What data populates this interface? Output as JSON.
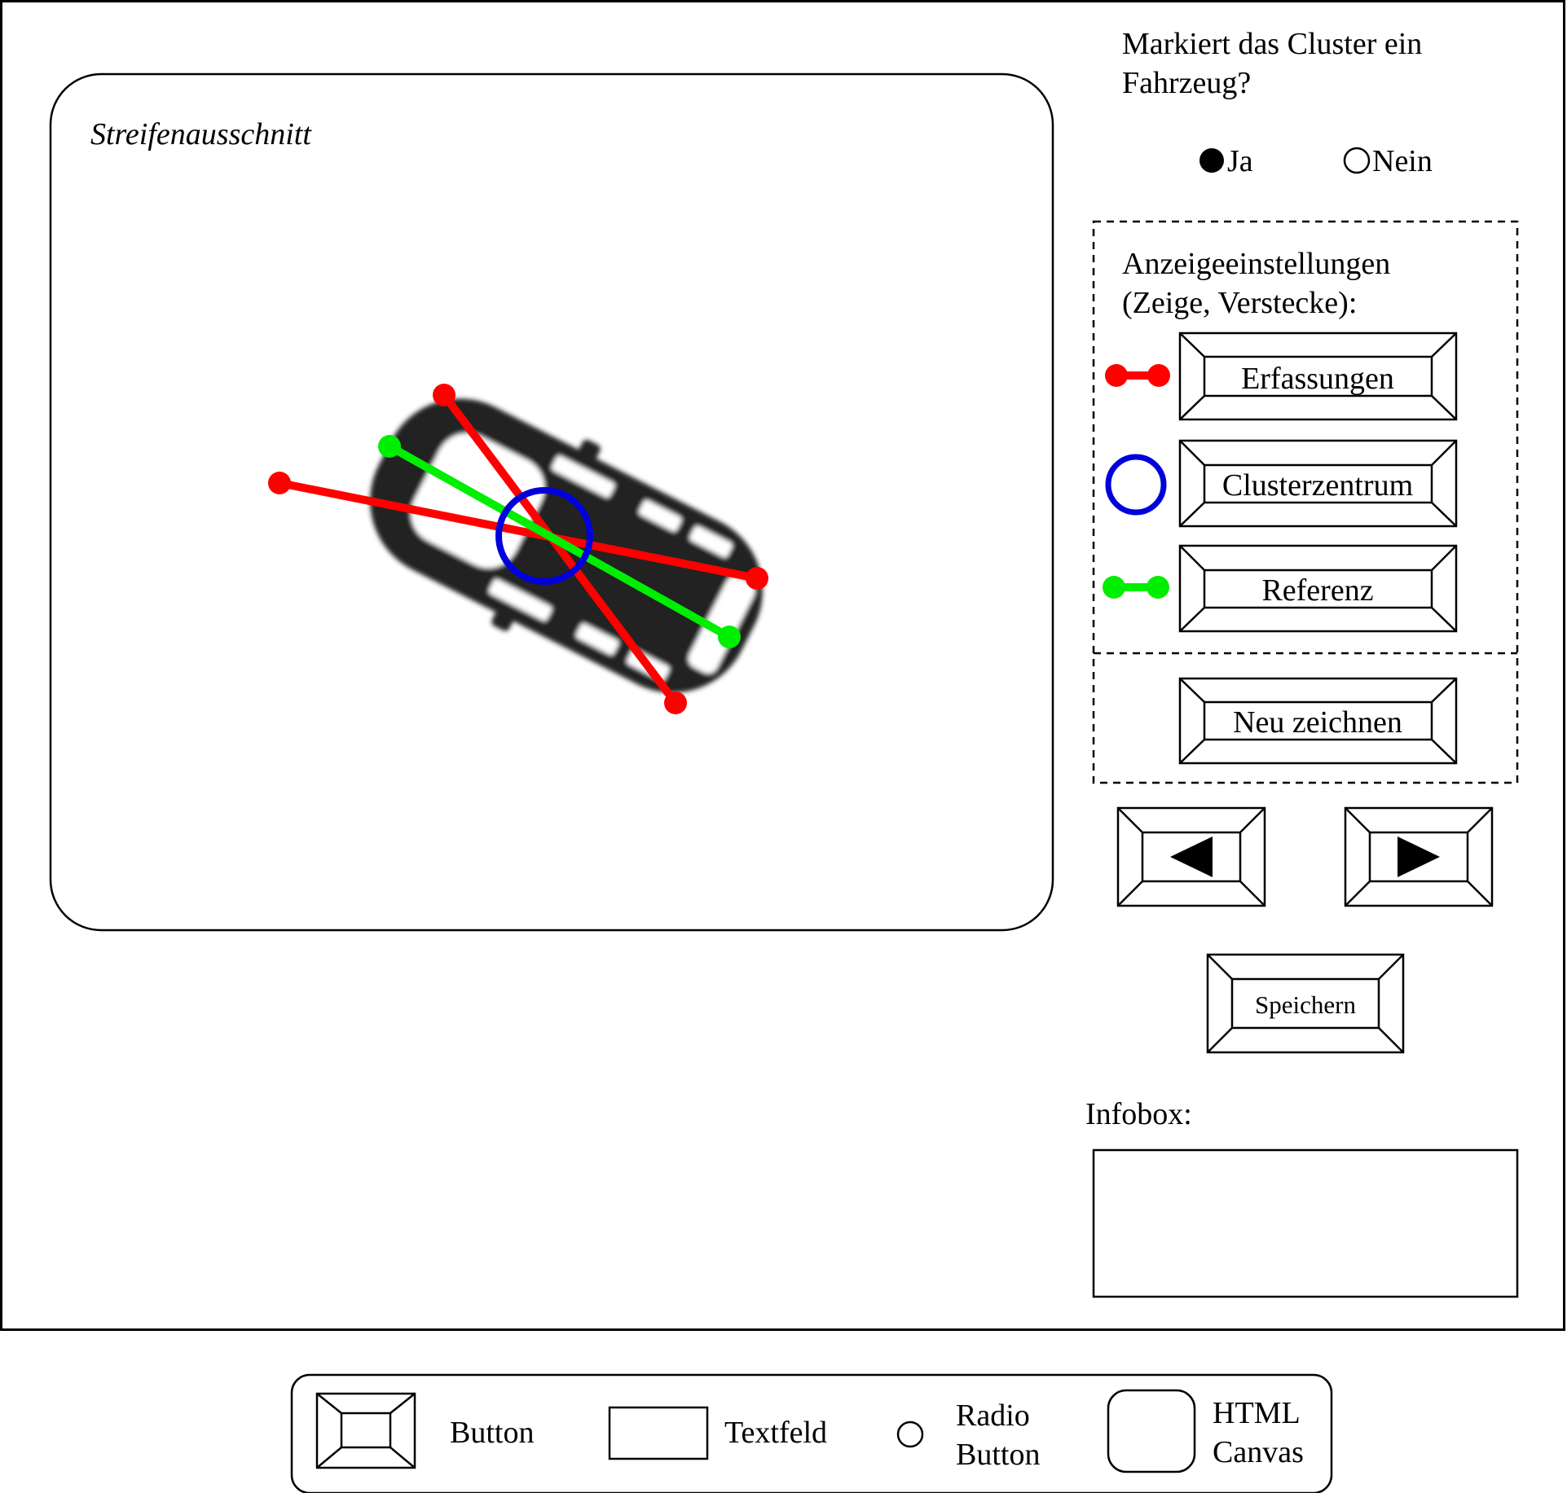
{
  "canvas": {
    "label": "Streifenausschnitt"
  },
  "question": {
    "line1": "Markiert das Cluster ein",
    "line2": "Fahrzeug?"
  },
  "radio": {
    "yes": "Ja",
    "no": "Nein",
    "selected": "Ja"
  },
  "display_settings": {
    "title_line1": "Anzeigeeinstellungen",
    "title_line2": "(Zeige, Verstecke):",
    "detections_button": "Erfassungen",
    "cluster_center_button": "Clusterzentrum",
    "reference_button": "Referenz",
    "redraw_button": "Neu zeichnen"
  },
  "navigation": {
    "prev_icon": "triangle-left-icon",
    "next_icon": "triangle-right-icon"
  },
  "save_button": "Speichern",
  "infobox": {
    "label": "Infobox:",
    "content": ""
  },
  "legend": {
    "button": "Button",
    "textfield": "Textfeld",
    "radio_line1": "Radio",
    "radio_line2": "Button",
    "canvas_line1": "HTML",
    "canvas_line2": "Canvas"
  },
  "colors": {
    "detections": "#ff0000",
    "cluster_center": "#0000dd",
    "reference": "#00ee00",
    "vehicle": "#222222"
  }
}
